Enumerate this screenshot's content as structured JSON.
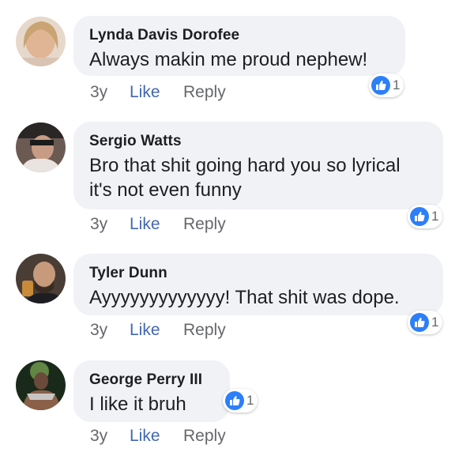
{
  "comments": [
    {
      "author": "Lynda Davis Dorofee",
      "text": "Always makin me proud nephew!",
      "time": "3y",
      "like": "Like",
      "reply": "Reply",
      "reactions": "1"
    },
    {
      "author": "Sergio Watts",
      "text": "Bro that shit going hard you so lyrical it's not even funny",
      "time": "3y",
      "like": "Like",
      "reply": "Reply",
      "reactions": "1"
    },
    {
      "author": "Tyler Dunn",
      "text": "Ayyyyyyyyyyyyy! That shit was dope.",
      "time": "3y",
      "like": "Like",
      "reply": "Reply",
      "reactions": "1"
    },
    {
      "author": "George Perry III",
      "text": "I like it bruh",
      "time": "3y",
      "like": "Like",
      "reply": "Reply",
      "reactions": "1"
    }
  ],
  "icons": {
    "reaction": "like-thumb-icon"
  },
  "colors": {
    "like": "#4267b2",
    "reaction": "#2d7ff9",
    "bubble": "#f0f2f5"
  }
}
